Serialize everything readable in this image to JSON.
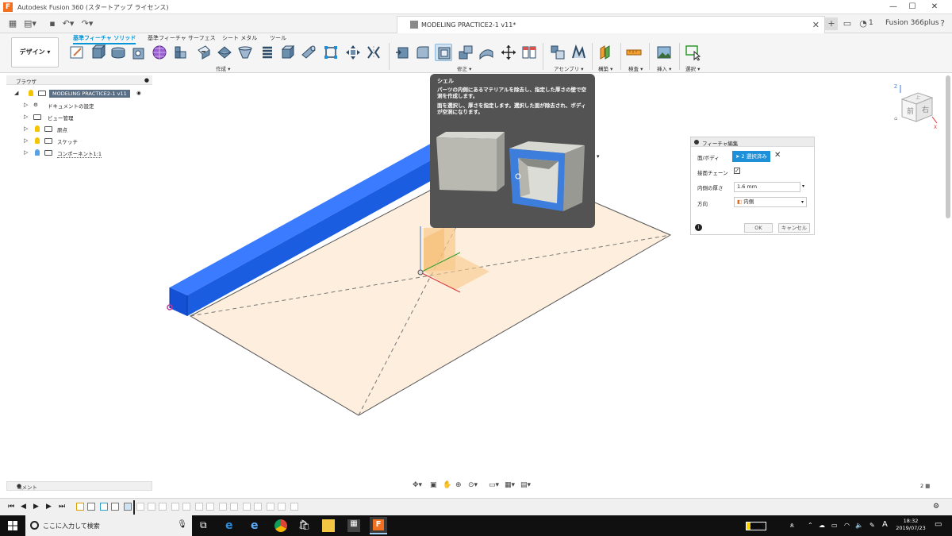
{
  "window": {
    "title": "Autodesk Fusion 360 (スタートアップ ライセンス)",
    "doc_title": "MODELING PRACTICE2-1 v11*",
    "user": "Fusion 366plus",
    "notifications": "1"
  },
  "ribbon": {
    "workspace": "デザイン ▾",
    "tabs": [
      "基準フィーチャ ソリッド",
      "基準フィーチャ サーフェス",
      "シート メタル",
      "ツール"
    ],
    "groups": {
      "create": "作成 ▾",
      "modify": "修正 ▾",
      "assemble": "アセンブリ ▾",
      "construct": "構築 ▾",
      "inspect": "検査 ▾",
      "insert": "挿入 ▾",
      "select": "選択 ▾"
    }
  },
  "browser": {
    "header": "ブラウザ",
    "root": "MODELING PRACTICE2-1 v11",
    "items": [
      "ドキュメントの設定",
      "ビュー管理",
      "原点",
      "スケッチ",
      "コンポーネント1:1"
    ]
  },
  "tooltip": {
    "title": "シェル",
    "line1": "パーツの内側にあるマテリアルを除去し、指定した厚さの壁で空洞を作成します。",
    "line2": "面を選択し、厚さを指定します。選択した面が除去され、ボディが空洞になります。"
  },
  "dialog": {
    "title": "フィーチャ編集",
    "face_body_label": "面/ボディ",
    "face_body_value": "2 選択済み",
    "tangent_chain_label": "接面チェーン",
    "inside_thickness_label": "内側の厚さ",
    "inside_thickness_value": "1.6 mm",
    "direction_label": "方向",
    "direction_value": "内側",
    "ok": "OK",
    "cancel": "キャンセル"
  },
  "viewcube": {
    "front": "前",
    "right": "右",
    "top": "上",
    "z": "Z",
    "x": "X"
  },
  "comments": {
    "label": "コメント"
  },
  "status": {
    "count": "2"
  },
  "taskbar": {
    "search_placeholder": "ここに入力して検索",
    "battery": "20%",
    "ime": "A",
    "time": "18:32",
    "date": "2019/07/23"
  },
  "colors": {
    "accent": "#0696d7",
    "body_blue": "#1a5de0",
    "plane": "#fdeedd",
    "tooltip_bg": "#535353"
  }
}
